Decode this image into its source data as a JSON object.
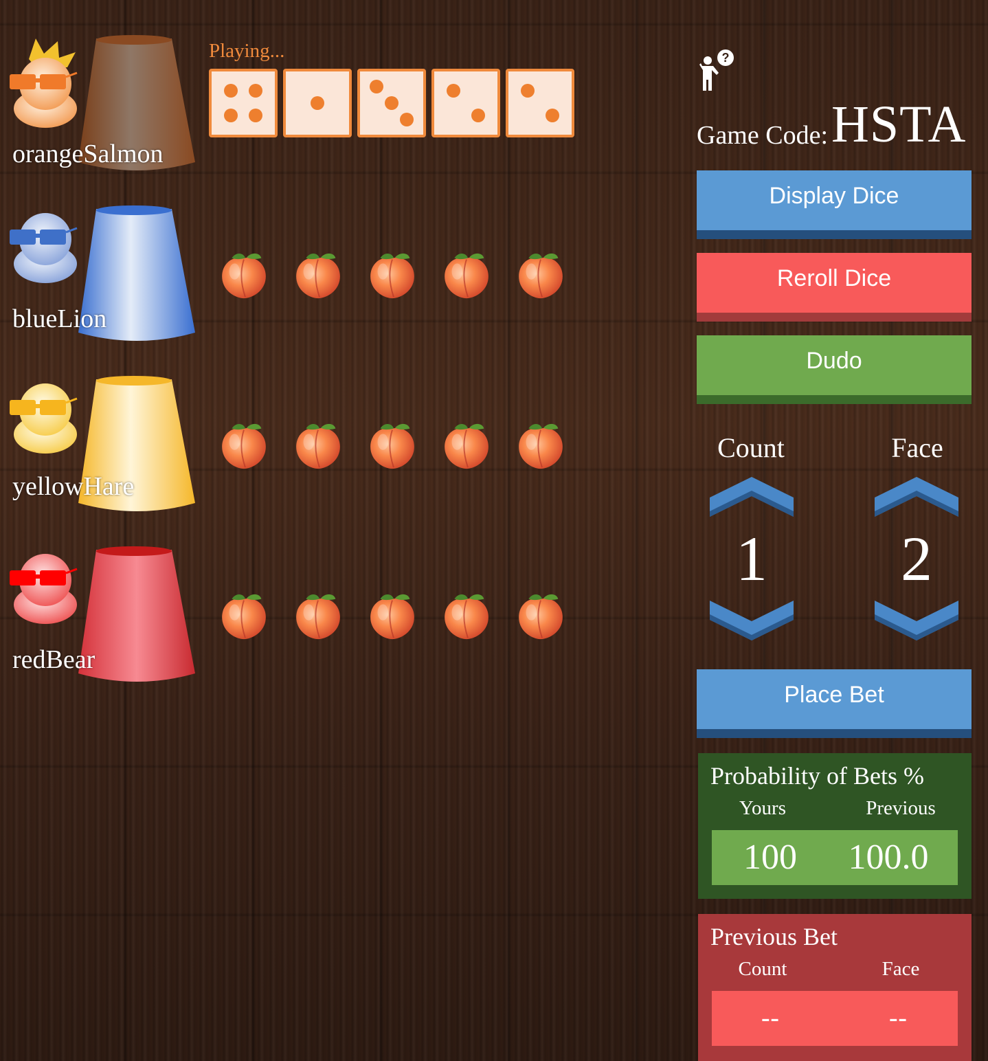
{
  "status": {
    "playing_label": "Playing..."
  },
  "my_dice": [
    4,
    1,
    3,
    2,
    2
  ],
  "players": [
    {
      "name": "orangeSalmon",
      "color": "#f08a3c",
      "cup_color": "#8b5a3c",
      "has_crown": true
    },
    {
      "name": "blueLion",
      "color": "#4a7fd0",
      "cup_color": "#4a7fd0",
      "has_crown": false,
      "hidden_dice": 5,
      "dice_icon": "peach-icon"
    },
    {
      "name": "yellowHare",
      "color": "#f9c43b",
      "cup_color": "#f9c43b",
      "has_crown": false,
      "hidden_dice": 5,
      "dice_icon": "peach-icon"
    },
    {
      "name": "redBear",
      "color": "#e83a3a",
      "cup_color": "#e83a3a",
      "has_crown": false,
      "hidden_dice": 5,
      "dice_icon": "peach-icon"
    }
  ],
  "game": {
    "code_label": "Game Code:",
    "code": "HSTA",
    "help_icon": "help-person-icon"
  },
  "buttons": {
    "display_dice": "Display Dice",
    "reroll_dice": "Reroll Dice",
    "dudo": "Dudo",
    "place_bet": "Place Bet"
  },
  "bet_selector": {
    "count_label": "Count",
    "face_label": "Face",
    "count_value": "1",
    "face_value": "2"
  },
  "probability": {
    "title": "Probability of Bets %",
    "yours_label": "Yours",
    "previous_label": "Previous",
    "yours_value": "100",
    "previous_value": "100.0"
  },
  "previous_bet": {
    "title": "Previous Bet",
    "count_label": "Count",
    "face_label": "Face",
    "count_value": "--",
    "face_value": "--"
  },
  "colors": {
    "blue_button": "#5b9ad4",
    "red_button": "#f85a5a",
    "green_button": "#70aa4e",
    "dice_accent": "#f08a3c"
  }
}
